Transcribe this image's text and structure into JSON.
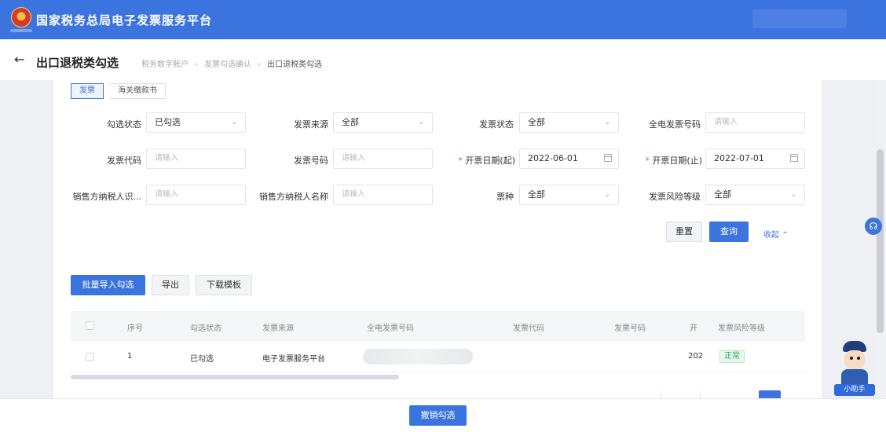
{
  "header": {
    "site_title": "国家税务总局电子发票服务平台"
  },
  "titlebar": {
    "back_icon": "arrow-left-icon",
    "page_title": "出口退税类勾选",
    "breadcrumb": [
      "税务数字账户",
      "发票勾选确认",
      "出口退税类勾选"
    ]
  },
  "tabs": [
    "发票",
    "海关缴款书"
  ],
  "filters": {
    "row1": [
      {
        "label": "勾选状态",
        "value": "已勾选",
        "type": "select"
      },
      {
        "label": "发票来源",
        "value": "全部",
        "type": "select"
      },
      {
        "label": "发票状态",
        "value": "全部",
        "type": "select"
      },
      {
        "label": "全电发票号码",
        "value": "请输入",
        "type": "input"
      }
    ],
    "row2": [
      {
        "label": "发票代码",
        "value": "请输入",
        "type": "input"
      },
      {
        "label": "发票号码",
        "value": "请输入",
        "type": "input"
      },
      {
        "label": "开票日期(起)",
        "value": "2022-06-01",
        "type": "date",
        "required": true
      },
      {
        "label": "开票日期(止)",
        "value": "2022-07-01",
        "type": "date",
        "required": true
      }
    ],
    "row3": [
      {
        "label": "销售方纳税人识...",
        "value": "请输入",
        "type": "input"
      },
      {
        "label": "销售方纳税人名称",
        "value": "请输入",
        "type": "input"
      },
      {
        "label": "票种",
        "value": "全部",
        "type": "select"
      },
      {
        "label": "发票风险等级",
        "value": "全部",
        "type": "select"
      }
    ]
  },
  "actions": {
    "reset": "重置",
    "query": "查询",
    "collapse": "收起",
    "required_mark": "*"
  },
  "toolbar": {
    "batch_import": "批量导入勾选",
    "export": "导出",
    "download_template": "下载模板"
  },
  "table": {
    "columns": [
      "序号",
      "勾选状态",
      "发票来源",
      "全电发票号码",
      "发票代码",
      "发票号码",
      "开",
      "发票风险等级"
    ],
    "rows": [
      {
        "index": "1",
        "status": "已勾选",
        "source": "电子发票服务平台",
        "number": "",
        "code": "",
        "invoice_no": "",
        "date_partial": "202",
        "risk": "正常"
      }
    ]
  },
  "footer": {
    "submit": "撤销勾选"
  },
  "assistant": {
    "label": "小助手"
  },
  "colors": {
    "primary": "#3b73df",
    "header": "#3b73df",
    "success": "#2aa35a"
  }
}
